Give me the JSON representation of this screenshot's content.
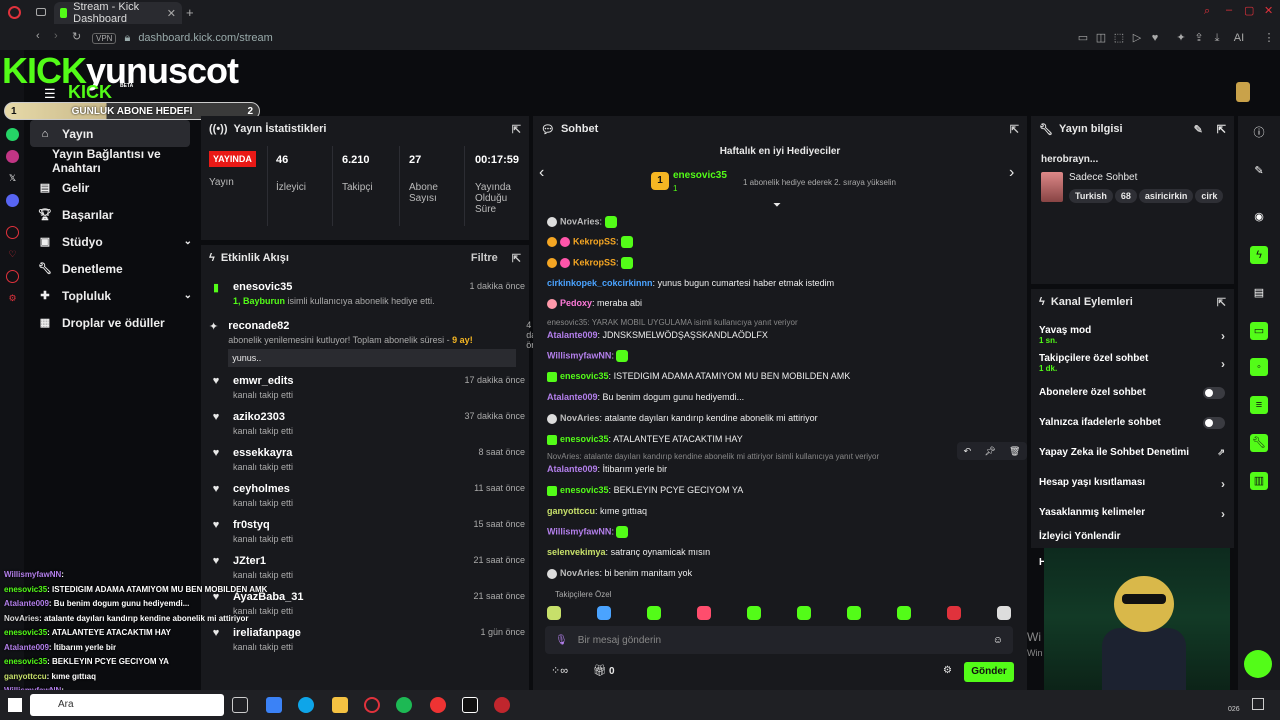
{
  "browser": {
    "tab_title": "Stream - Kick Dashboard",
    "vpn": "VPN",
    "url": "dashboard.kick.com/stream",
    "ai_label": "AI"
  },
  "header": {
    "logo_kick": "KICK",
    "channel": "yunuscot",
    "sublogo": "KICK",
    "beta": "BETA"
  },
  "goal": {
    "start": "1",
    "label": "GUNLUK ABONE HEDEFI",
    "end": "2",
    "progress": 0.4
  },
  "nav": [
    {
      "label": "Yayın",
      "icon": "home-icon"
    },
    {
      "label": "Yayın Bağlantısı ve Anahtarı",
      "icon": ""
    },
    {
      "label": "Gelir",
      "icon": "chart-icon"
    },
    {
      "label": "Başarılar",
      "icon": "trophy-icon"
    },
    {
      "label": "Stüdyo",
      "icon": "studio-icon"
    },
    {
      "label": "Denetleme",
      "icon": "wrench-icon"
    },
    {
      "label": "Topluluk",
      "icon": "community-icon"
    },
    {
      "label": "Droplar ve ödüller",
      "icon": "gift-icon"
    }
  ],
  "stats": {
    "title": "Yayın İstatistikleri",
    "live_badge": "YAYINDA",
    "live_label": "Yayın",
    "viewers": "46",
    "viewers_label": "İzleyici",
    "followers": "6.210",
    "followers_label": "Takipçi",
    "subs": "27",
    "subs_label1": "Abone",
    "subs_label2": "Sayısı",
    "uptime": "00:17:59",
    "uptime_l1": "Yayında",
    "uptime_l2": "Olduğu",
    "uptime_l3": "Süre"
  },
  "activity": {
    "title": "Etkinlik Akışı",
    "filter": "Filtre",
    "items": [
      {
        "name": "enesovic35",
        "sub": "isimli kullanıcıya abonelik hediye etti.",
        "sub_hl": "1, Bayburun",
        "time": "1 dakika önce"
      },
      {
        "name": "reconade82",
        "sub": "abonelik yenilemesini kutluyor! Toplam abonelik süresi - ",
        "sub_hl": "9 ay!",
        "time": "4 dakika önce",
        "msg": "yunus.."
      },
      {
        "name": "emwr_edits",
        "sub": "kanalı takip etti",
        "time": "17 dakika önce"
      },
      {
        "name": "aziko2303",
        "sub": "kanalı takip etti",
        "time": "37 dakika önce"
      },
      {
        "name": "essekkayra",
        "sub": "kanalı takip etti",
        "time": "8 saat önce"
      },
      {
        "name": "ceyholmes",
        "sub": "kanalı takip etti",
        "time": "11 saat önce"
      },
      {
        "name": "fr0styq",
        "sub": "kanalı takip etti",
        "time": "15 saat önce"
      },
      {
        "name": "JZter1",
        "sub": "kanalı takip etti",
        "time": "21 saat önce"
      },
      {
        "name": "AyazBaba_31",
        "sub": "kanalı takip etti",
        "time": "21 saat önce"
      },
      {
        "name": "ireliafanpage",
        "sub": "kanalı takip etti",
        "time": "1 gün önce"
      }
    ]
  },
  "chat": {
    "title": "Sohbet",
    "gifters_title": "Haftalık en iyi Hediyeciler",
    "gifter_name": "enesovic35",
    "gifter_count": "1",
    "gifter_rank": "1",
    "gifter_note": "1 abonelik hediye ederek 2. sıraya yükselin",
    "messages": [
      {
        "user": "NovAries",
        "color": "u-gray",
        "text": ""
      },
      {
        "user": "KekropSS",
        "color": "u-orange",
        "text": ""
      },
      {
        "user": "KekropSS",
        "color": "u-orange",
        "text": ""
      },
      {
        "user": "cirkinkopek_cokcirkinnn",
        "color": "u-blue",
        "text": "yunus bugun cumartesi haber etmak istedim"
      },
      {
        "user": "Pedoxy",
        "color": "u-pink",
        "text": "meraba abi"
      },
      {
        "user": "Atalante009",
        "color": "u-purple",
        "text": "JDNSKSMELWÖDŞAŞSKANDLAÖDLFX",
        "reply": "enesovic35: YARAK MOBIL UYGULAMA isimli kullanıcıya yanıt veriyor"
      },
      {
        "user": "WillismyfawNN",
        "color": "u-purple",
        "text": ""
      },
      {
        "user": "enesovic35",
        "color": "u-green",
        "text": "ISTEDIGIM ADAMA ATAMIYOM MU BEN MOBILDEN AMK"
      },
      {
        "user": "Atalante009",
        "color": "u-purple",
        "text": "Bu benim dogum gunu hediyemdi..."
      },
      {
        "user": "NovAries",
        "color": "u-gray",
        "text": "atalante dayıları kandırıp kendine abonelik mi attiriyor"
      },
      {
        "user": "enesovic35",
        "color": "u-green",
        "text": "ATALANTEYE ATACAKTIM HAY"
      },
      {
        "user": "Atalante009",
        "color": "u-purple",
        "text": "İtibarım yerle bir",
        "reply": "NovAries: atalante dayıları kandırıp kendine abonelik mi attiriyor isimli kullanıcıya yanıt veriyor"
      },
      {
        "user": "enesovic35",
        "color": "u-green",
        "text": "BEKLEYIN PCYE GECIYOM YA"
      },
      {
        "user": "ganyottccu",
        "color": "u-olive",
        "text": "kıme gıttıaq"
      },
      {
        "user": "WillismyfawNN",
        "color": "u-purple",
        "text": ""
      },
      {
        "user": "selenvekimya",
        "color": "u-olive",
        "text": "satranç oynamicak mısın"
      },
      {
        "user": "NovAries",
        "color": "u-gray",
        "text": "bi benim manitam yok"
      }
    ],
    "followers_only": "Takipçilere Özel",
    "placeholder": "Bir mesaj gönderin",
    "points": "0",
    "send": "Gönder"
  },
  "stream_info": {
    "title": "Yayın bilgisi",
    "stream_title": "herobrayn...",
    "category": "Sadece Sohbet",
    "tags": [
      "Turkish",
      "68",
      "asiricirkin",
      "cirk"
    ]
  },
  "channel_actions": {
    "title": "Kanal Eylemleri",
    "items": [
      {
        "label": "Yavaş mod",
        "sub": "1 sn.",
        "kind": "arrow"
      },
      {
        "label": "Takipçilere özel sohbet",
        "sub": "1 dk.",
        "kind": "arrow"
      },
      {
        "label": "Abonelere özel sohbet",
        "sub": "",
        "kind": "toggle"
      },
      {
        "label": "Yalnızca ifadelerle sohbet",
        "sub": "",
        "kind": "toggle"
      },
      {
        "label": "Yapay Zeka ile Sohbet Denetimi",
        "sub": "",
        "kind": "external"
      },
      {
        "label": "Hesap yaşı kısıtlaması",
        "sub": "",
        "kind": "arrow"
      },
      {
        "label": "Yasaklanmış kelimeler",
        "sub": "",
        "kind": "arrow"
      },
      {
        "label": "İzleyici Yönlendir",
        "sub": "",
        "kind": "none"
      },
      {
        "label": "H",
        "sub": "",
        "kind": "none"
      }
    ]
  },
  "overlay_chat": [
    {
      "user": "WillismyfawNN",
      "text": ":"
    },
    {
      "user": "enesovic35",
      "text": ": ISTEDIGIM ADAMA ATAMIYOM MU BEN MOBILDEN AMK"
    },
    {
      "user": "Atalante009",
      "text": ": Bu benim dogum gunu hediyemdi..."
    },
    {
      "user": "NovAries",
      "text": ": atalante dayıları kandırıp kendine abonelik mi attiriyor"
    },
    {
      "user": "enesovic35",
      "text": ": ATALANTEYE ATACAKTIM HAY"
    },
    {
      "user": "Atalante009",
      "text": ": İtibarım yerle bir"
    },
    {
      "user": "enesovic35",
      "text": ": BEKLEYIN PCYE GECIYOM YA"
    },
    {
      "user": "ganyottccu",
      "text": ": kıme gıttıaq"
    },
    {
      "user": "WillismyfawNN",
      "text": ":"
    }
  ],
  "taskbar": {
    "search": "Ara",
    "time": "026",
    "win_text": "Wi",
    "win_text2": "Win"
  },
  "colors": {
    "kick_green": "#53fc18",
    "panel": "#18191d",
    "live_red": "#e91916"
  }
}
